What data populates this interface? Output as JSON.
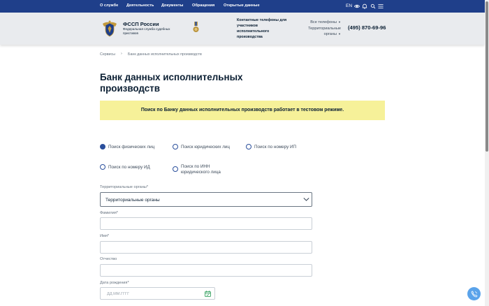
{
  "topnav": {
    "items": [
      "О службе",
      "Деятельность",
      "Документы",
      "Обращения",
      "Открытые данные"
    ],
    "lang": "EN",
    "icons": [
      "eye-icon",
      "bell-icon",
      "search-icon",
      "menu-icon"
    ]
  },
  "header": {
    "org_name": "ФССП России",
    "org_subtitle": "Федеральная служба судебных приставов",
    "contacts_title": "Контактные телефоны для участников исполнительного производства",
    "all_phones": "Все телефоны",
    "territorial": "Территориальные органы",
    "phone": "(495) 870-69-96"
  },
  "breadcrumb": {
    "items": [
      "Сервисы",
      "Банк данных исполнительных производств"
    ],
    "separator": "›"
  },
  "page": {
    "title": "Банк данных исполнительных производств",
    "notice": "Поиск по Банку данных исполнительных производств работает в тестовом режиме."
  },
  "search_types": [
    {
      "label": "Поиск физических лиц",
      "checked": true
    },
    {
      "label": "Поиск юридических лиц",
      "checked": false
    },
    {
      "label": "Поиск по номеру ИП",
      "checked": false
    },
    {
      "label": "Поиск по номеру ИД",
      "checked": false
    },
    {
      "label": "Поиск по ИНН юридического лица",
      "checked": false
    }
  ],
  "form": {
    "territorial_label": "Территориальные органы*",
    "territorial_value": "Территориальные органы",
    "lastname_label": "Фамилия*",
    "firstname_label": "Имя*",
    "patronymic_label": "Отчество",
    "birthdate_label": "Дата рождения*",
    "birthdate_placeholder": "ДД.ММ.ГГГГ"
  },
  "colors": {
    "nav_bg": "#1f3f8a",
    "header_bg": "#e9ebee",
    "notice_bg": "#f6f199",
    "accent": "#2a4f9c",
    "call_button": "#5aa3ea"
  }
}
